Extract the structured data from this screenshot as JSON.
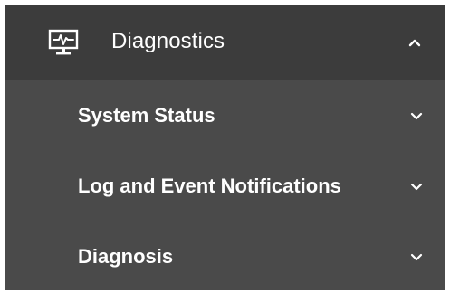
{
  "menu": {
    "section": {
      "title": "Diagnostics",
      "icon": "monitor-pulse-icon",
      "expanded": true,
      "toggle_icon": "chevron-up-icon"
    },
    "items": [
      {
        "label": "System Status",
        "icon": "chevron-down-icon"
      },
      {
        "label": "Log and Event Notifications",
        "icon": "chevron-down-icon"
      },
      {
        "label": "Diagnosis",
        "icon": "chevron-down-icon"
      }
    ]
  },
  "colors": {
    "panel": "#4a4a4a",
    "header": "#3c3c3c",
    "text": "#ffffff",
    "accent": "#009c8e"
  }
}
